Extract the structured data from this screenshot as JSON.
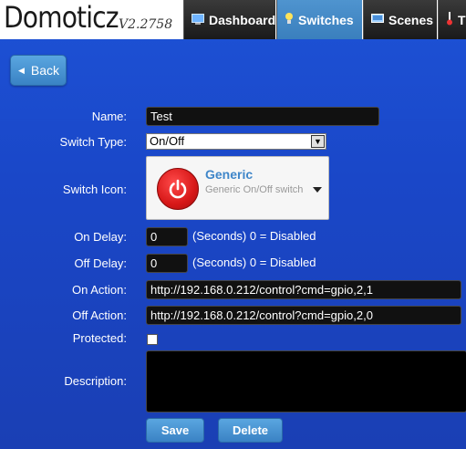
{
  "app": {
    "title": "Domoticz",
    "version": "V2.2758"
  },
  "nav": {
    "tabs": [
      {
        "label": "Dashboard",
        "icon": "monitor-icon"
      },
      {
        "label": "Switches",
        "icon": "lightbulb-icon",
        "active": true
      },
      {
        "label": "Scenes",
        "icon": "scenes-icon"
      },
      {
        "label": "T",
        "icon": "thermometer-icon"
      }
    ]
  },
  "back_button": {
    "label": "Back"
  },
  "form": {
    "name": {
      "label": "Name:",
      "value": "Test"
    },
    "switch_type": {
      "label": "Switch Type:",
      "value": "On/Off"
    },
    "switch_icon": {
      "label": "Switch Icon:",
      "name": "Generic",
      "description": "Generic On/Off switch"
    },
    "on_delay": {
      "label": "On Delay:",
      "value": "0",
      "hint": "(Seconds) 0 = Disabled"
    },
    "off_delay": {
      "label": "Off Delay:",
      "value": "0",
      "hint": "(Seconds) 0 = Disabled"
    },
    "on_action": {
      "label": "On Action:",
      "value": "http://192.168.0.212/control?cmd=gpio,2,1"
    },
    "off_action": {
      "label": "Off Action:",
      "value": "http://192.168.0.212/control?cmd=gpio,2,0"
    },
    "protected": {
      "label": "Protected:",
      "checked": false
    },
    "description": {
      "label": "Description:",
      "value": ""
    }
  },
  "buttons": {
    "save": "Save",
    "delete": "Delete"
  },
  "colors": {
    "background": "#1a47c8",
    "accent": "#3f86c9",
    "power_icon": "#d71818"
  }
}
